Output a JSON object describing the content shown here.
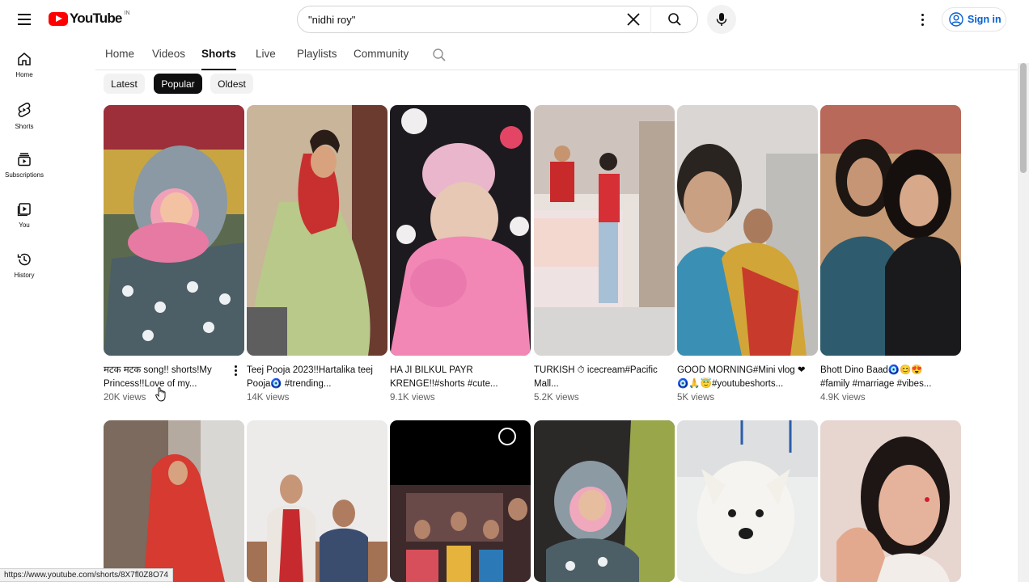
{
  "header": {
    "logo_text": "YouTube",
    "country": "IN",
    "search_value": "\"nidhi roy\"",
    "signin_label": "Sign in"
  },
  "guide": [
    {
      "label": "Home",
      "icon": "home-icon"
    },
    {
      "label": "Shorts",
      "icon": "shorts-icon"
    },
    {
      "label": "Subscriptions",
      "icon": "subscriptions-icon"
    },
    {
      "label": "You",
      "icon": "you-icon"
    },
    {
      "label": "History",
      "icon": "history-icon"
    }
  ],
  "tabs": [
    {
      "label": "Home"
    },
    {
      "label": "Videos"
    },
    {
      "label": "Shorts",
      "active": true
    },
    {
      "label": "Live"
    },
    {
      "label": "Playlists"
    },
    {
      "label": "Community"
    }
  ],
  "chips": [
    {
      "label": "Latest"
    },
    {
      "label": "Popular",
      "active": true
    },
    {
      "label": "Oldest"
    }
  ],
  "shorts_row1": [
    {
      "title": "मटक मटक song!! shorts!My Princess!!Love of my...",
      "views": "20K views"
    },
    {
      "title": "Teej Pooja 2023!!Hartalika teej Pooja🧿 #trending...",
      "views": "14K views"
    },
    {
      "title": "HA JI BILKUL PAYR KRENGE!!#shorts #cute...",
      "views": "9.1K views"
    },
    {
      "title": "TURKISH ⏱ icecream#Pacific Mall...",
      "views": "5.2K views"
    },
    {
      "title": "GOOD MORNING#Mini vlog ❤🧿🙏😇#youtubeshorts...",
      "views": "5K views"
    },
    {
      "title": "Bhott Dino Baad🧿😊😍 #family #marriage #vibes...",
      "views": "4.9K views"
    }
  ],
  "status_url": "https://www.youtube.com/shorts/8X7fl0Z8O74",
  "colors": {
    "brand": "#ff0000",
    "link": "#065fd4",
    "text": "#0f0f0f",
    "secondary": "#606060"
  }
}
